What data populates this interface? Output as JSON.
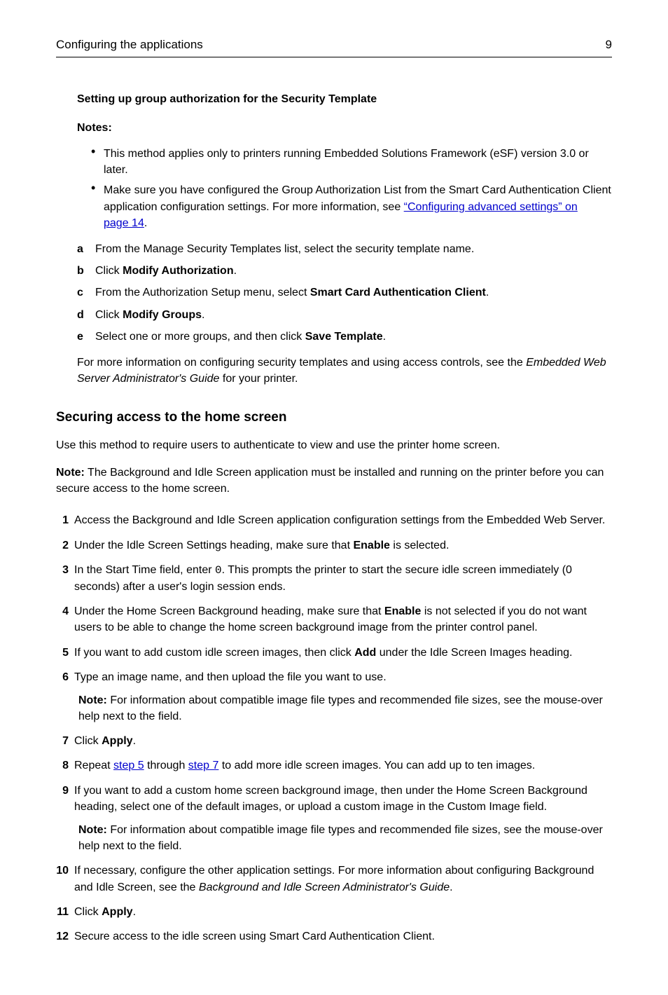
{
  "header": {
    "title": "Configuring the applications",
    "page_number": "9"
  },
  "sec1": {
    "title": "Setting up group authorization for the Security Template",
    "notes_label": "Notes:",
    "note1": "This method applies only to printers running Embedded Solutions Framework (eSF) version 3.0 or later.",
    "note2_a": "Make sure you have configured the Group Authorization List from the Smart Card Authentication Client application configuration settings. For more information, see ",
    "note2_link": "“Configuring advanced settings” on page 14",
    "note2_b": ".",
    "a": "From the Manage Security Templates list, select the security template name.",
    "b_a": "Click ",
    "b_b": "Modify Authorization",
    "b_c": ".",
    "c_a": "From the Authorization Setup menu, select ",
    "c_b": "Smart Card Authentication Client",
    "c_c": ".",
    "d_a": "Click ",
    "d_b": "Modify Groups",
    "d_c": ".",
    "e_a": "Select one or more groups, and then click ",
    "e_b": "Save Template",
    "e_c": ".",
    "closing_a": "For more information on configuring security templates and using access controls, see the ",
    "closing_i": "Embedded Web Server Administrator's Guide",
    "closing_b": " for your printer."
  },
  "sec2": {
    "title": "Securing access to the home screen",
    "intro": "Use this method to require users to authenticate to view and use the printer home screen.",
    "note_label": "Note:",
    "note_body": " The Background and Idle Screen application must be installed and running on the printer before you can secure access to the home screen.",
    "s1": "Access the Background and Idle Screen application configuration settings from the Embedded Web Server.",
    "s2_a": "Under the Idle Screen Settings heading, make sure that ",
    "s2_b": "Enable",
    "s2_c": " is selected.",
    "s3_a": "In the Start Time field, enter ",
    "s3_code": "0",
    "s3_b": ". This prompts the printer to start the secure idle screen immediately (0 seconds) after a user's login session ends.",
    "s4_a": "Under the Home Screen Background heading, make sure that ",
    "s4_b": "Enable",
    "s4_c": " is not selected if you do not want users to be able to change the home screen background image from the printer control panel.",
    "s5_a": "If you want to add custom idle screen images, then click ",
    "s5_b": "Add",
    "s5_c": " under the Idle Screen Images heading.",
    "s6": "Type an image name, and then upload the file you want to use.",
    "s6_note_label": "Note:",
    "s6_note_body": " For information about compatible image file types and recommended file sizes, see the mouse‑over help next to the field.",
    "s7_a": "Click ",
    "s7_b": "Apply",
    "s7_c": ".",
    "s8_a": "Repeat ",
    "s8_link1": "step 5",
    "s8_b": " through ",
    "s8_link2": "step 7",
    "s8_c": " to add more idle screen images. You can add up to ten images.",
    "s9": "If you want to add a custom home screen background image, then under the Home Screen Background heading, select one of the default images, or upload a custom image in the Custom Image field.",
    "s9_note_label": "Note:",
    "s9_note_body": " For information about compatible image file types and recommended file sizes, see the mouse‑over help next to the field.",
    "s10_a": "If necessary, configure the other application settings. For more information about configuring Background and Idle Screen, see the ",
    "s10_i": "Background and Idle Screen Administrator's Guide",
    "s10_b": ".",
    "s11_a": "Click ",
    "s11_b": "Apply",
    "s11_c": ".",
    "s12": "Secure access to the idle screen using Smart Card Authentication Client."
  },
  "markers": {
    "a": "a",
    "b": "b",
    "c": "c",
    "d": "d",
    "e": "e",
    "n1": "1",
    "n2": "2",
    "n3": "3",
    "n4": "4",
    "n5": "5",
    "n6": "6",
    "n7": "7",
    "n8": "8",
    "n9": "9",
    "n10": "10",
    "n11": "11",
    "n12": "12"
  }
}
